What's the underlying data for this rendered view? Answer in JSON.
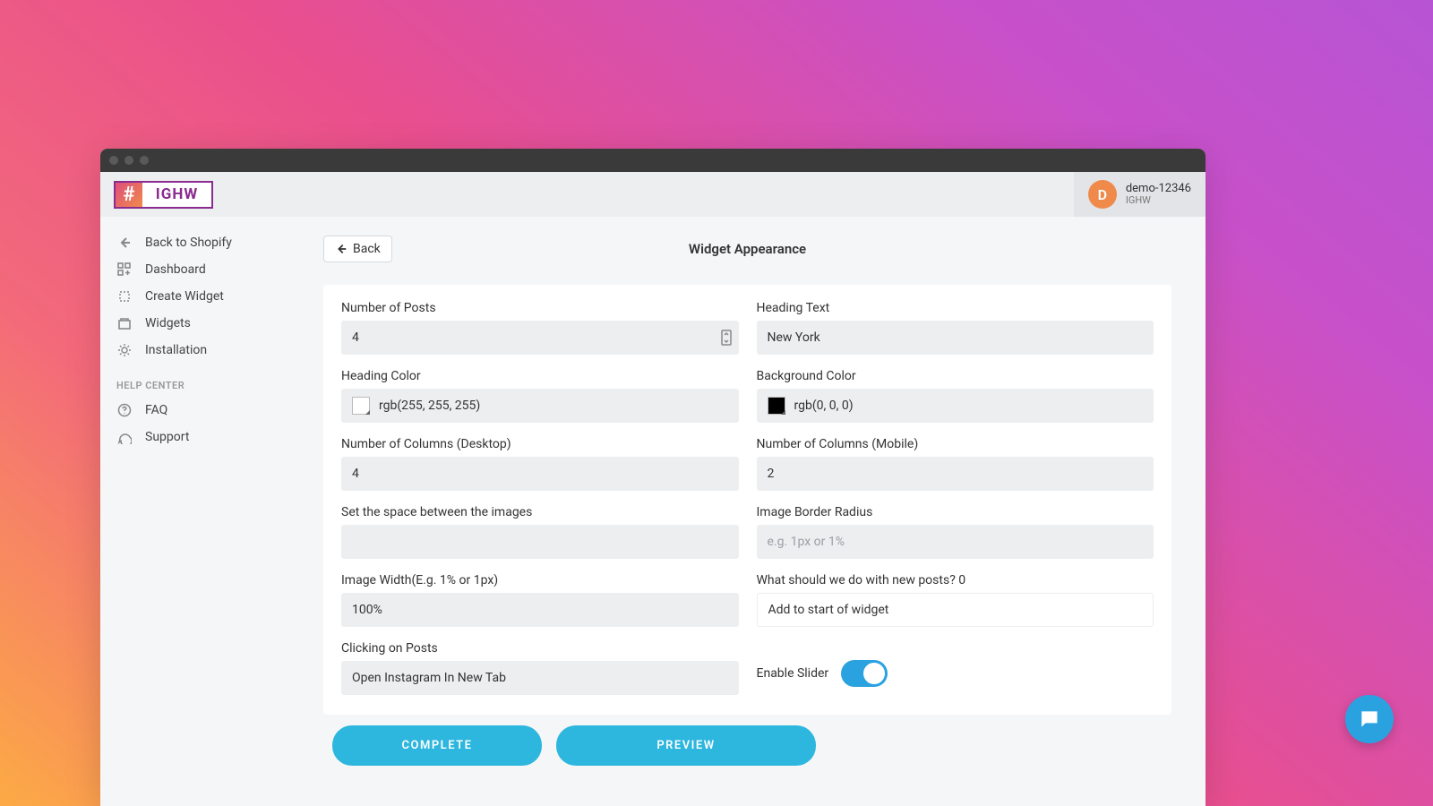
{
  "logo": {
    "hash": "#",
    "text": "IGHW"
  },
  "user": {
    "initial": "D",
    "name": "demo-12346",
    "app": "IGHW"
  },
  "sidebar": {
    "items": [
      {
        "label": "Back to Shopify"
      },
      {
        "label": "Dashboard"
      },
      {
        "label": "Create Widget"
      },
      {
        "label": "Widgets"
      },
      {
        "label": "Installation"
      }
    ],
    "section": "HELP CENTER",
    "help": [
      {
        "label": "FAQ"
      },
      {
        "label": "Support"
      }
    ]
  },
  "header": {
    "back": "Back",
    "title": "Widget Appearance"
  },
  "form": {
    "num_posts": {
      "label": "Number of Posts",
      "value": "4"
    },
    "heading_text": {
      "label": "Heading Text",
      "value": "New York"
    },
    "heading_color": {
      "label": "Heading Color",
      "value": "rgb(255, 255, 255)"
    },
    "bg_color": {
      "label": "Background Color",
      "value": "rgb(0, 0, 0)"
    },
    "cols_desktop": {
      "label": "Number of Columns (Desktop)",
      "value": "4"
    },
    "cols_mobile": {
      "label": "Number of Columns (Mobile)",
      "value": "2"
    },
    "spacing": {
      "label": "Set the space between the images",
      "value": ""
    },
    "border_radius": {
      "label": "Image Border Radius",
      "placeholder": "e.g. 1px or 1%",
      "value": ""
    },
    "image_width": {
      "label": "Image Width(E.g. 1% or 1px)",
      "value": "100%"
    },
    "new_posts": {
      "label": "What should we do with new posts? 0",
      "value": "Add to start of widget"
    },
    "click_posts": {
      "label": "Clicking on Posts",
      "value": "Open Instagram In New Tab"
    },
    "enable_slider": {
      "label": "Enable Slider",
      "value": true
    }
  },
  "actions": {
    "complete": "COMPLETE",
    "preview": "PREVIEW"
  }
}
